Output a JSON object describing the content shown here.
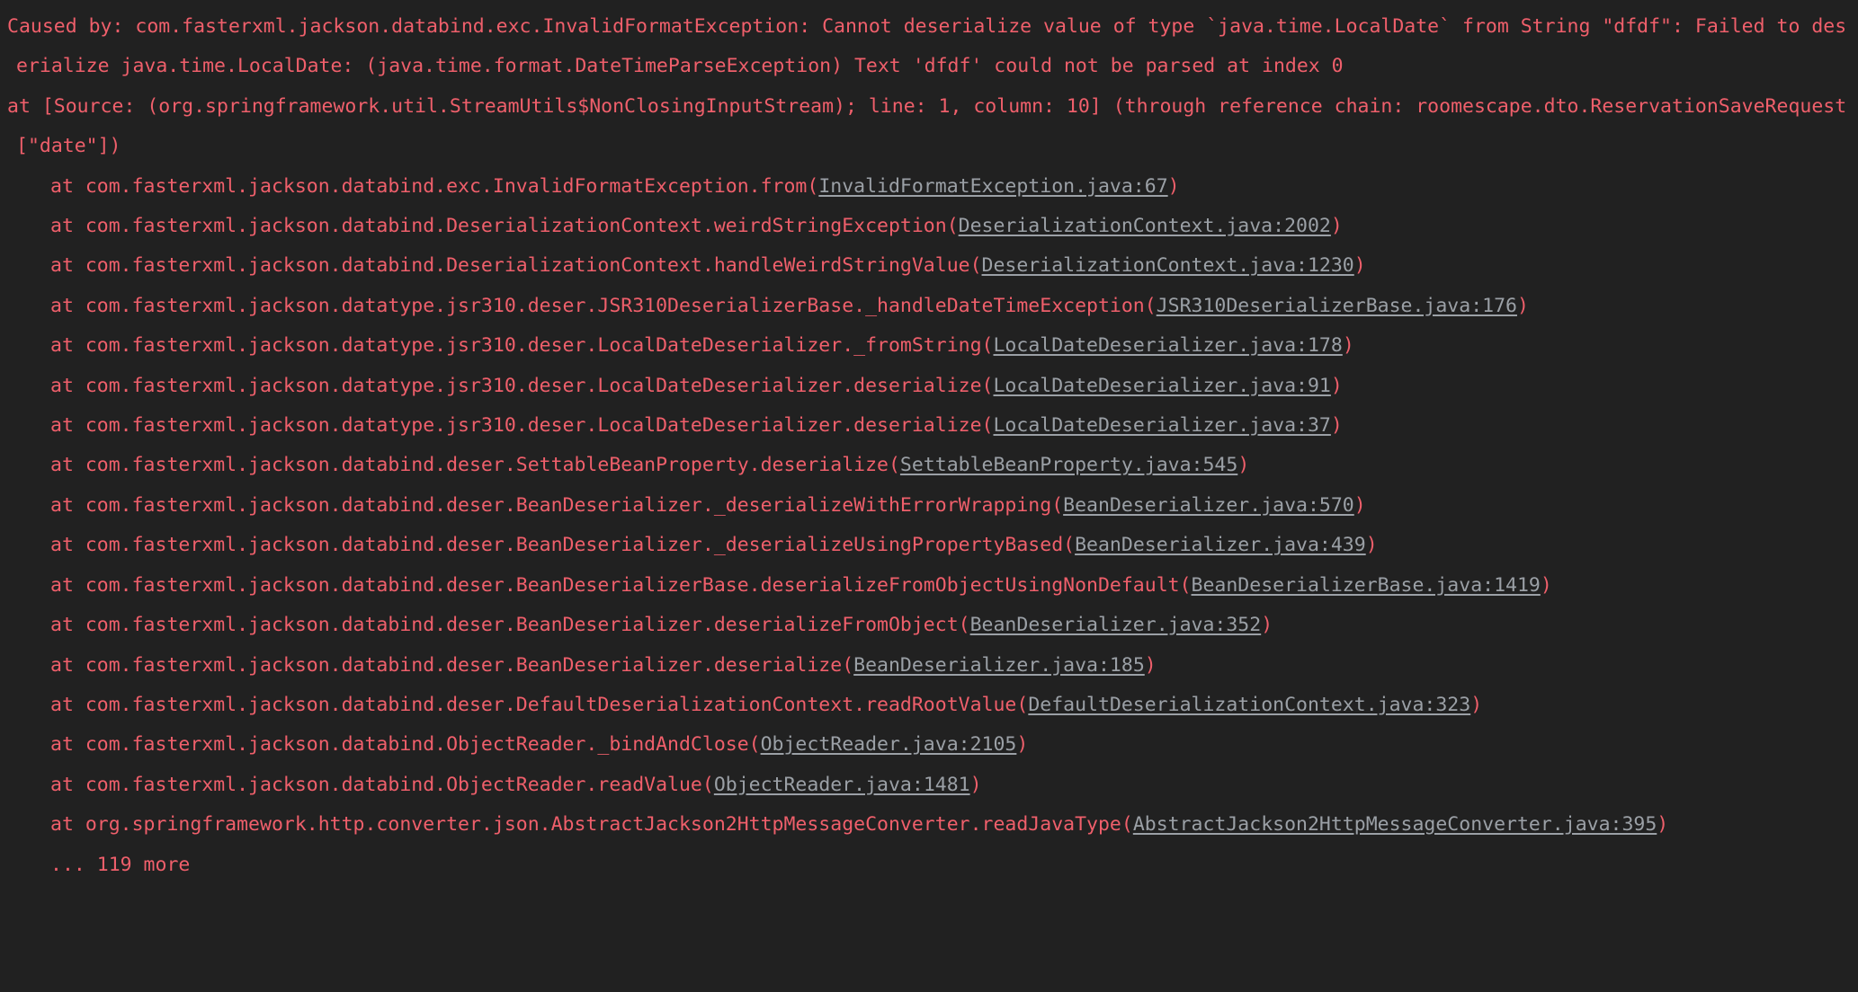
{
  "console": {
    "theme": {
      "background": "#212121",
      "text_color": "#ef5f6b",
      "link_color": "#9ba0a6"
    },
    "lines": [
      {
        "indent": 0,
        "segments": [
          {
            "type": "text",
            "value": "Caused by: com.fasterxml.jackson.databind.exc.InvalidFormatException: Cannot deserialize value of type `java.time.LocalDate` from String \"dfdf\": Failed to deserialize java.time.LocalDate: (java.time.format.DateTimeParseException) Text 'dfdf' could not be parsed at index 0"
          }
        ]
      },
      {
        "indent": 0,
        "segments": [
          {
            "type": "text",
            "value": "at [Source: (org.springframework.util.StreamUtils$NonClosingInputStream); line: 1, column: 10] (through reference chain: roomescape.dto.ReservationSaveRequest[\"date\"])"
          }
        ]
      },
      {
        "indent": 1,
        "segments": [
          {
            "type": "text",
            "value": "at com.fasterxml.jackson.databind.exc.InvalidFormatException.from("
          },
          {
            "type": "link",
            "value": "InvalidFormatException.java:67"
          },
          {
            "type": "text",
            "value": ")"
          }
        ]
      },
      {
        "indent": 1,
        "segments": [
          {
            "type": "text",
            "value": "at com.fasterxml.jackson.databind.DeserializationContext.weirdStringException("
          },
          {
            "type": "link",
            "value": "DeserializationContext.java:2002"
          },
          {
            "type": "text",
            "value": ")"
          }
        ]
      },
      {
        "indent": 1,
        "segments": [
          {
            "type": "text",
            "value": "at com.fasterxml.jackson.databind.DeserializationContext.handleWeirdStringValue("
          },
          {
            "type": "link",
            "value": "DeserializationContext.java:1230"
          },
          {
            "type": "text",
            "value": ")"
          }
        ]
      },
      {
        "indent": 1,
        "segments": [
          {
            "type": "text",
            "value": "at com.fasterxml.jackson.datatype.jsr310.deser.JSR310DeserializerBase._handleDateTimeException("
          },
          {
            "type": "link",
            "value": "JSR310DeserializerBase.java:176"
          },
          {
            "type": "text",
            "value": ")"
          }
        ]
      },
      {
        "indent": 1,
        "segments": [
          {
            "type": "text",
            "value": "at com.fasterxml.jackson.datatype.jsr310.deser.LocalDateDeserializer._fromString("
          },
          {
            "type": "link",
            "value": "LocalDateDeserializer.java:178"
          },
          {
            "type": "text",
            "value": ")"
          }
        ]
      },
      {
        "indent": 1,
        "segments": [
          {
            "type": "text",
            "value": "at com.fasterxml.jackson.datatype.jsr310.deser.LocalDateDeserializer.deserialize("
          },
          {
            "type": "link",
            "value": "LocalDateDeserializer.java:91"
          },
          {
            "type": "text",
            "value": ")"
          }
        ]
      },
      {
        "indent": 1,
        "segments": [
          {
            "type": "text",
            "value": "at com.fasterxml.jackson.datatype.jsr310.deser.LocalDateDeserializer.deserialize("
          },
          {
            "type": "link",
            "value": "LocalDateDeserializer.java:37"
          },
          {
            "type": "text",
            "value": ")"
          }
        ]
      },
      {
        "indent": 1,
        "segments": [
          {
            "type": "text",
            "value": "at com.fasterxml.jackson.databind.deser.SettableBeanProperty.deserialize("
          },
          {
            "type": "link",
            "value": "SettableBeanProperty.java:545"
          },
          {
            "type": "text",
            "value": ")"
          }
        ]
      },
      {
        "indent": 1,
        "segments": [
          {
            "type": "text",
            "value": "at com.fasterxml.jackson.databind.deser.BeanDeserializer._deserializeWithErrorWrapping("
          },
          {
            "type": "link",
            "value": "BeanDeserializer.java:570"
          },
          {
            "type": "text",
            "value": ")"
          }
        ]
      },
      {
        "indent": 1,
        "segments": [
          {
            "type": "text",
            "value": "at com.fasterxml.jackson.databind.deser.BeanDeserializer._deserializeUsingPropertyBased("
          },
          {
            "type": "link",
            "value": "BeanDeserializer.java:439"
          },
          {
            "type": "text",
            "value": ")"
          }
        ]
      },
      {
        "indent": 1,
        "segments": [
          {
            "type": "text",
            "value": "at com.fasterxml.jackson.databind.deser.BeanDeserializerBase.deserializeFromObjectUsingNonDefault("
          },
          {
            "type": "link",
            "value": "BeanDeserializerBase.java:1419"
          },
          {
            "type": "text",
            "value": ")"
          }
        ]
      },
      {
        "indent": 1,
        "segments": [
          {
            "type": "text",
            "value": "at com.fasterxml.jackson.databind.deser.BeanDeserializer.deserializeFromObject("
          },
          {
            "type": "link",
            "value": "BeanDeserializer.java:352"
          },
          {
            "type": "text",
            "value": ")"
          }
        ]
      },
      {
        "indent": 1,
        "segments": [
          {
            "type": "text",
            "value": "at com.fasterxml.jackson.databind.deser.BeanDeserializer.deserialize("
          },
          {
            "type": "link",
            "value": "BeanDeserializer.java:185"
          },
          {
            "type": "text",
            "value": ")"
          }
        ]
      },
      {
        "indent": 1,
        "segments": [
          {
            "type": "text",
            "value": "at com.fasterxml.jackson.databind.deser.DefaultDeserializationContext.readRootValue("
          },
          {
            "type": "link",
            "value": "DefaultDeserializationContext.java:323"
          },
          {
            "type": "text",
            "value": ")"
          }
        ]
      },
      {
        "indent": 1,
        "segments": [
          {
            "type": "text",
            "value": "at com.fasterxml.jackson.databind.ObjectReader._bindAndClose("
          },
          {
            "type": "link",
            "value": "ObjectReader.java:2105"
          },
          {
            "type": "text",
            "value": ")"
          }
        ]
      },
      {
        "indent": 1,
        "segments": [
          {
            "type": "text",
            "value": "at com.fasterxml.jackson.databind.ObjectReader.readValue("
          },
          {
            "type": "link",
            "value": "ObjectReader.java:1481"
          },
          {
            "type": "text",
            "value": ")"
          }
        ]
      },
      {
        "indent": 1,
        "segments": [
          {
            "type": "text",
            "value": "at org.springframework.http.converter.json.AbstractJackson2HttpMessageConverter.readJavaType("
          },
          {
            "type": "link",
            "value": "AbstractJackson2HttpMessageConverter.java:395"
          },
          {
            "type": "text",
            "value": ")"
          }
        ]
      },
      {
        "indent": 1,
        "segments": [
          {
            "type": "text",
            "value": "... 119 more"
          }
        ]
      }
    ]
  }
}
